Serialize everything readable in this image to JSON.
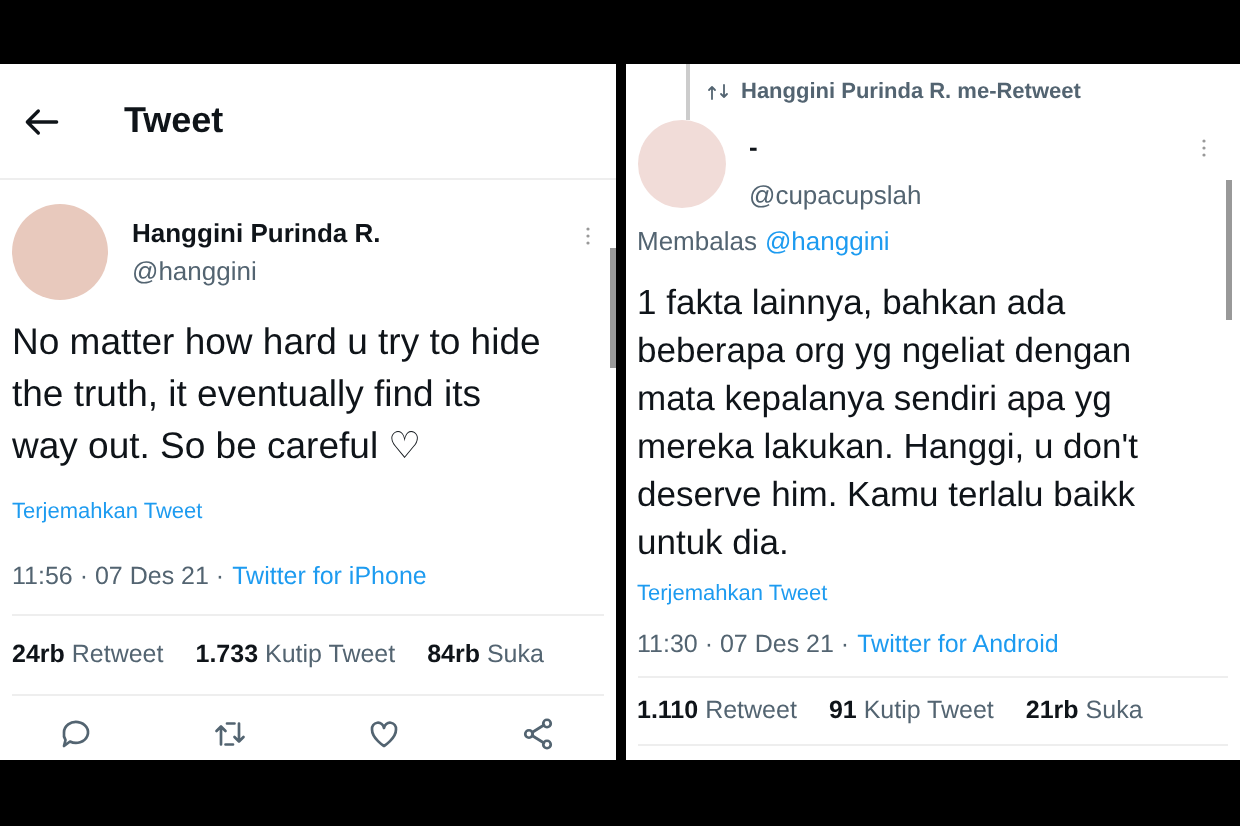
{
  "panels": [
    {
      "kind": "detail",
      "header": {
        "title": "Tweet"
      },
      "tweet": {
        "name": "Hanggini Purinda R.",
        "handle": "@hanggini",
        "text": "No matter how hard u try to hide the truth, it eventually find its way out. So be careful ♡",
        "translate": "Terjemahkan Tweet",
        "timestamp": "11:56 · 07 Des 21 ·",
        "source": "Twitter for iPhone",
        "stats": [
          {
            "count": "24rb",
            "label": "Retweet"
          },
          {
            "count": "1.733",
            "label": "Kutip Tweet"
          },
          {
            "count": "84rb",
            "label": "Suka"
          }
        ]
      }
    },
    {
      "kind": "reply",
      "retweeted_by": "Hanggini Purinda R. me-Retweet",
      "tweet": {
        "name": "-",
        "handle": "@cupacupslah",
        "reply_label": "Membalas",
        "reply_to": "@hanggini",
        "text": "1 fakta lainnya, bahkan ada beberapa org yg ngeliat dengan mata kepalanya sendiri apa yg mereka lakukan. Hanggi, u don't deserve him. Kamu terlalu baikk untuk dia.",
        "translate": "Terjemahkan Tweet",
        "timestamp": "11:30 · 07 Des 21 ·",
        "source": "Twitter for Android",
        "stats": [
          {
            "count": "1.110",
            "label": "Retweet"
          },
          {
            "count": "91",
            "label": "Kutip Tweet"
          },
          {
            "count": "21rb",
            "label": "Suka"
          }
        ]
      }
    }
  ]
}
